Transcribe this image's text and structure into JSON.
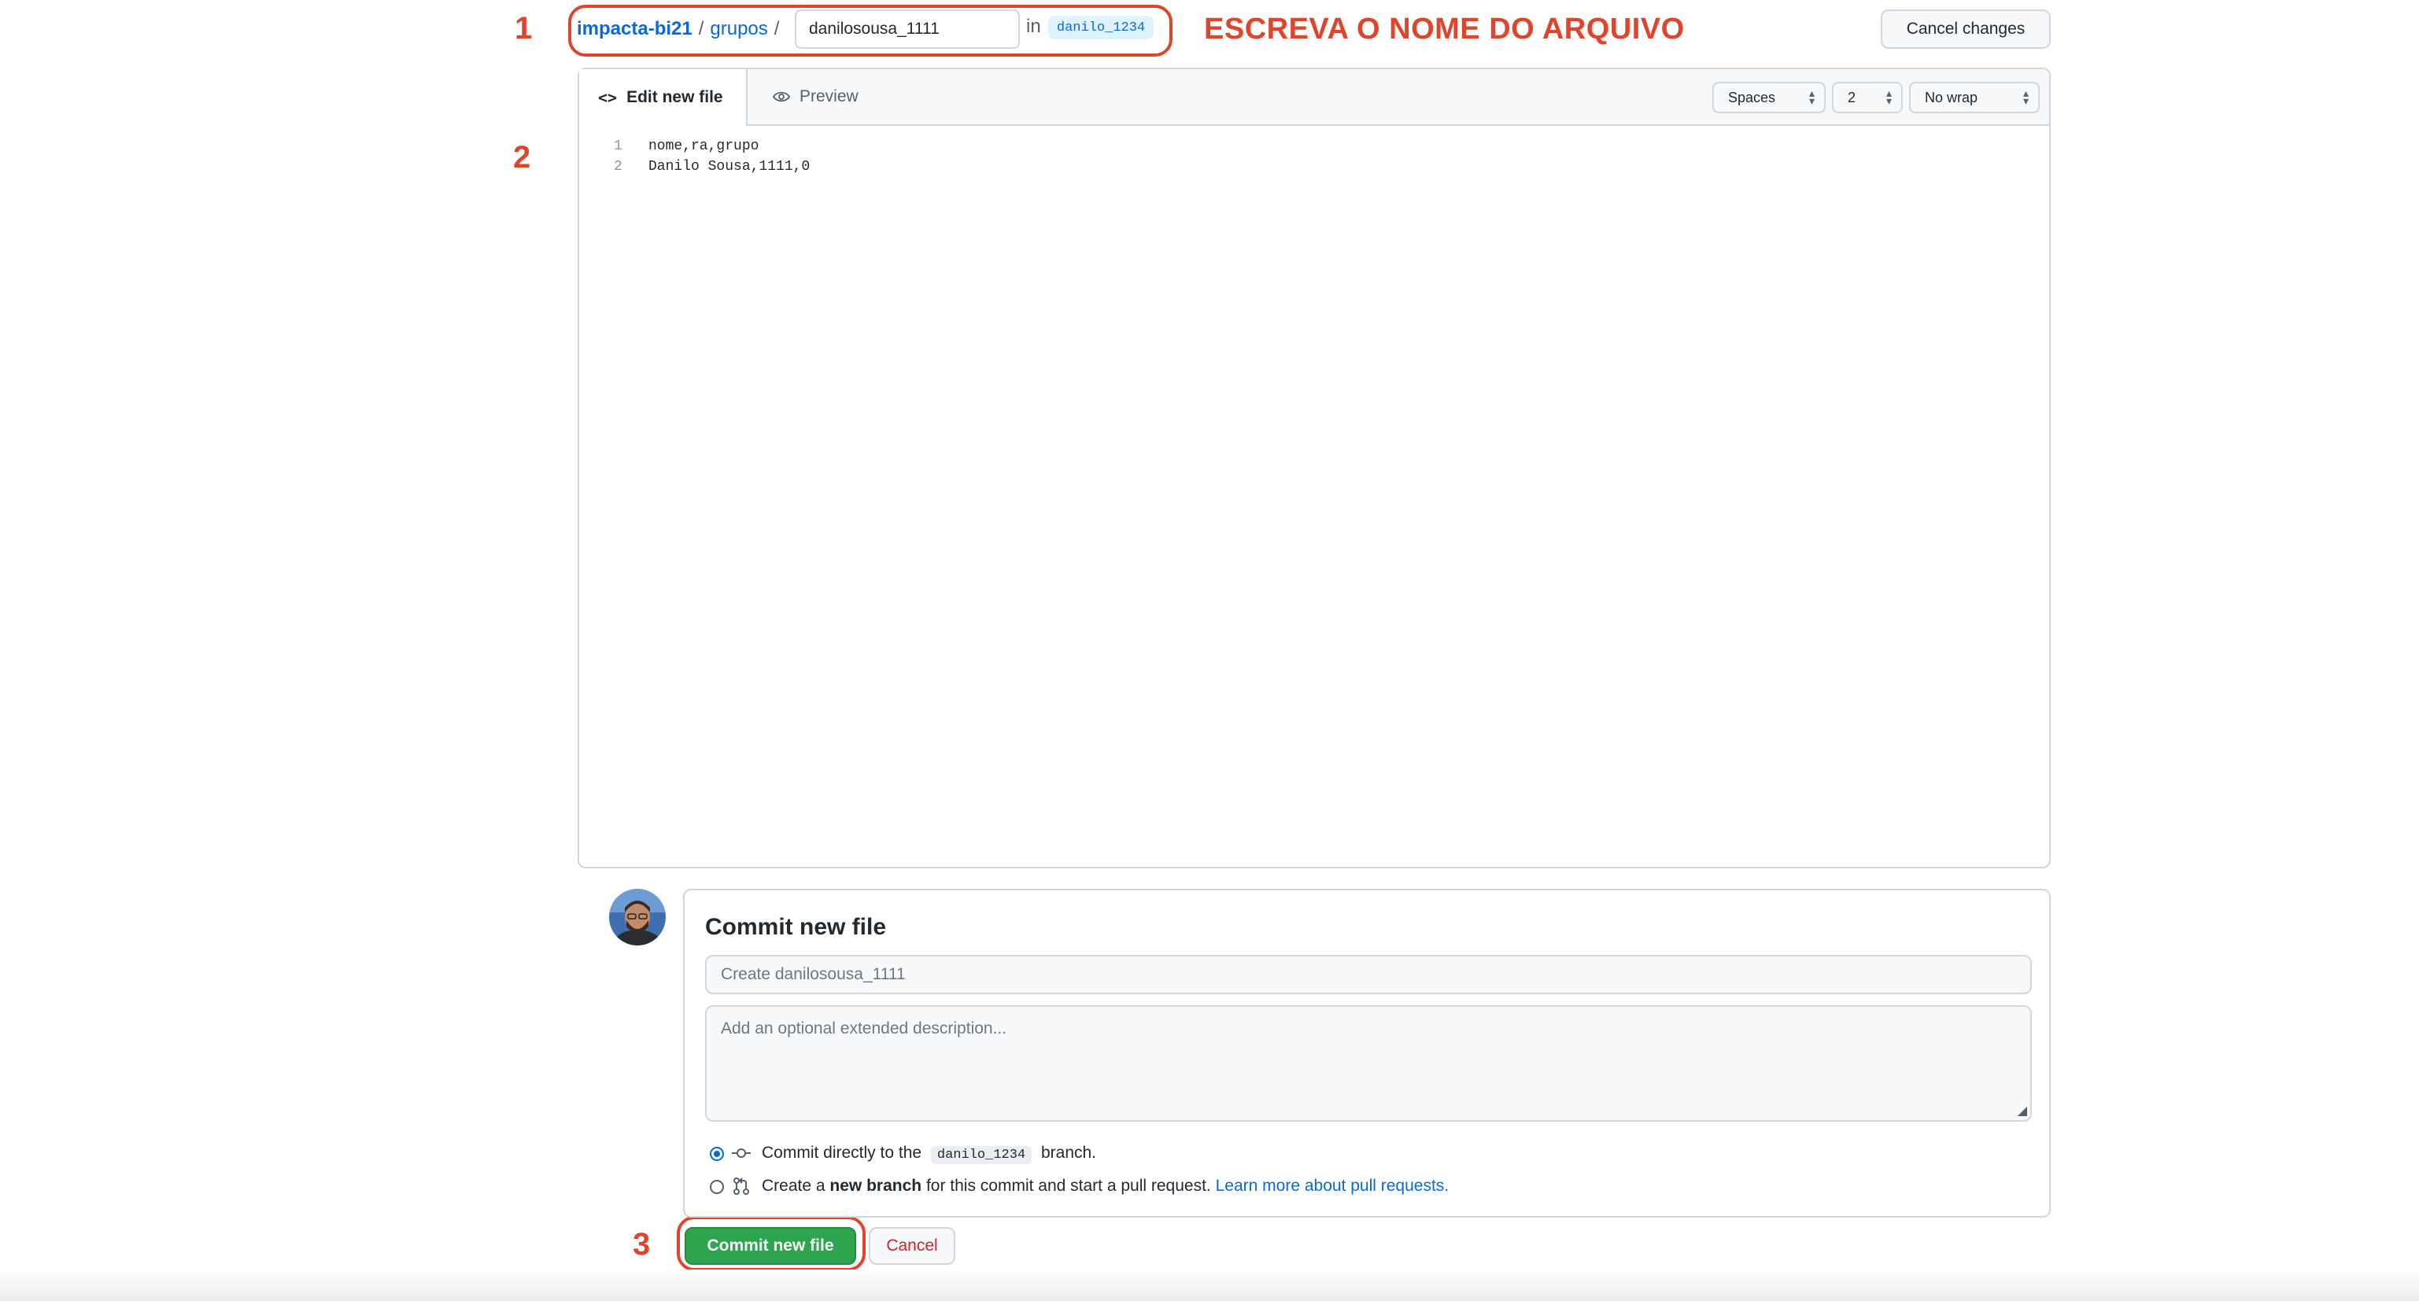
{
  "annotations": {
    "step1": "1",
    "step2": "2",
    "step3": "3",
    "instruction": "ESCREVA O NOME DO ARQUIVO"
  },
  "breadcrumb": {
    "repo": "impacta-bi21",
    "sep1": "/",
    "folder": "grupos",
    "sep2": "/",
    "filename": "danilosousa_1111",
    "in_label": "in",
    "branch": "danilo_1234"
  },
  "header": {
    "cancel_changes": "Cancel changes"
  },
  "editor": {
    "tab_edit": "Edit new file",
    "tab_preview": "Preview",
    "indent_mode": "Spaces",
    "indent_size": "2",
    "wrap_mode": "No wrap",
    "lines": [
      {
        "number": "1",
        "text": "nome,ra,grupo"
      },
      {
        "number": "2",
        "text": "Danilo Sousa,1111,0"
      }
    ]
  },
  "commit": {
    "title": "Commit new file",
    "summary_placeholder": "Create danilosousa_1111",
    "description_placeholder": "Add an optional extended description...",
    "option_direct_pre": "Commit directly to the",
    "option_direct_branch": "danilo_1234",
    "option_direct_post": "branch.",
    "option_new_pre": "Create a",
    "option_new_bold": "new branch",
    "option_new_post": "for this commit and start a pull request.",
    "option_new_link": "Learn more about pull requests.",
    "commit_button": "Commit new file",
    "cancel_button": "Cancel"
  },
  "colors": {
    "annotation_red": "#e0452c",
    "link_blue": "#0969da",
    "commit_green": "#2da44e",
    "cancel_red": "#cf222e"
  }
}
